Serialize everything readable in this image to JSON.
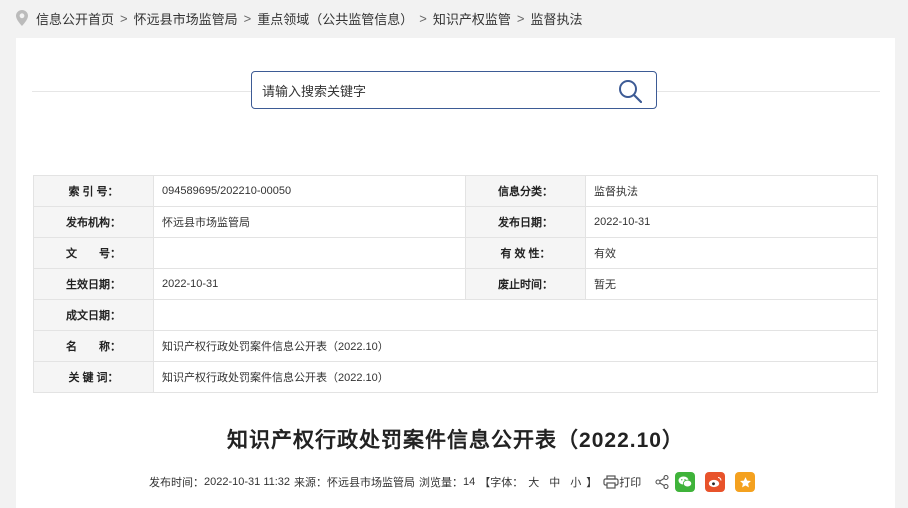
{
  "breadcrumb": {
    "items": [
      "信息公开首页",
      "怀远县市场监管局",
      "重点领域（公共监管信息）",
      "知识产权监管",
      "监督执法"
    ],
    "separator": ">"
  },
  "search": {
    "placeholder": "请输入搜索关键字"
  },
  "meta": {
    "index_label": "索 引 号：",
    "index_value": "094589695/202210-00050",
    "category_label": "信息分类：",
    "category_value": "监督执法",
    "org_label": "发布机构：",
    "org_value": "怀远县市场监管局",
    "pubdate_label": "发布日期：",
    "pubdate_value": "2022-10-31",
    "docno_label": "文　　号：",
    "docno_value": "",
    "validity_label": "有 效 性：",
    "validity_value": "有效",
    "effective_label": "生效日期：",
    "effective_value": "2022-10-31",
    "repeal_label": "废止时间：",
    "repeal_value": "暂无",
    "written_label": "成文日期：",
    "written_value": "",
    "name_label": "名　　称：",
    "name_value": "知识产权行政处罚案件信息公开表（2022.10）",
    "keywords_label": "关 键 词：",
    "keywords_value": "知识产权行政处罚案件信息公开表（2022.10）"
  },
  "article": {
    "title": "知识产权行政处罚案件信息公开表（2022.10）",
    "pub_time_label": "发布时间：",
    "pub_time": "2022-10-31 11:32",
    "source_label": "来源：",
    "source": "怀远县市场监管局",
    "views_label": "浏览量：",
    "views": "14",
    "font_open": "【字体：",
    "font_large": "大",
    "font_medium": "中",
    "font_small": "小",
    "font_close": "】",
    "print_label": "打印"
  },
  "colors": {
    "search_border": "#3d5b95",
    "wechat": "#3fb33a",
    "weibo": "#e8532b",
    "favorite": "#f4a11f"
  }
}
